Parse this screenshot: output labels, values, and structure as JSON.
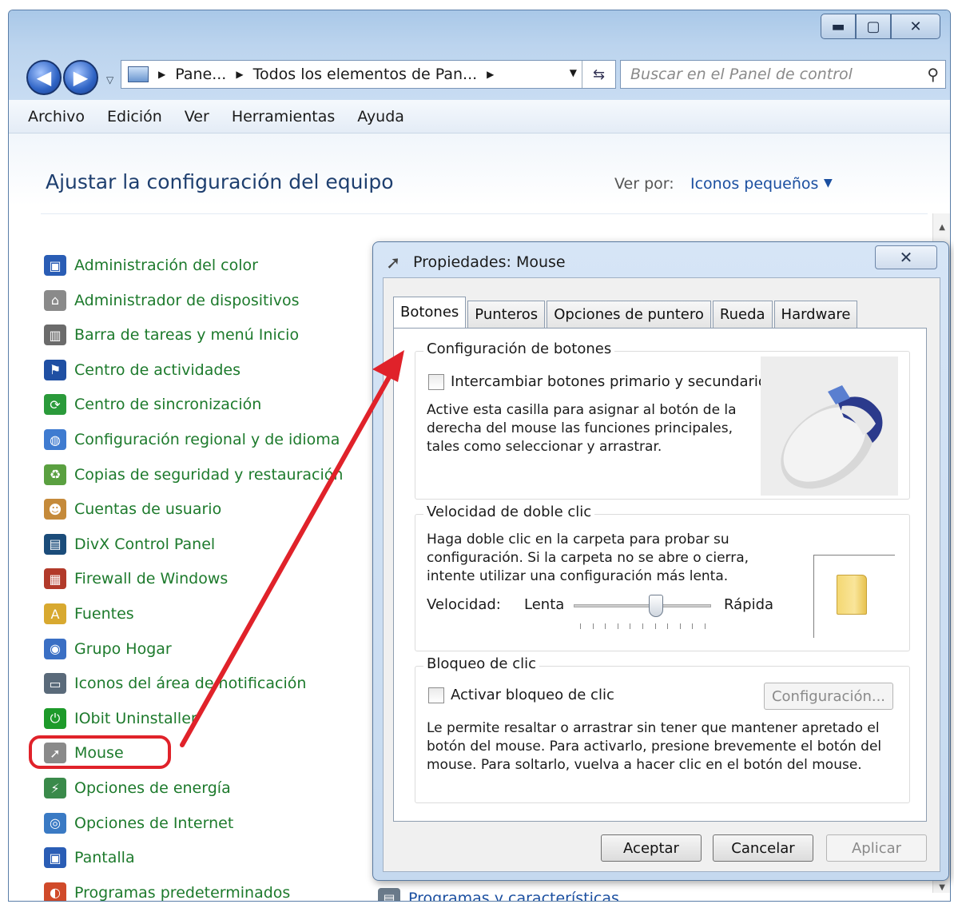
{
  "window": {
    "controls": {
      "minimize": "▬",
      "maximize": "▢",
      "close": "✕"
    }
  },
  "address": {
    "segments": [
      "Pane...",
      "Todos los elementos de Pan..."
    ],
    "search_placeholder": "Buscar en el Panel de control"
  },
  "menu": [
    "Archivo",
    "Edición",
    "Ver",
    "Herramientas",
    "Ayuda"
  ],
  "page": {
    "title": "Ajustar la configuración del equipo",
    "view_by_label": "Ver por:",
    "view_by_value": "Iconos pequeños"
  },
  "items": [
    {
      "label": "Administración del color",
      "icon": "monitor-color-icon",
      "color": "#2a5db5"
    },
    {
      "label": "Administrador de dispositivos",
      "icon": "device-manager-icon",
      "color": "#8a8a8a"
    },
    {
      "label": "Barra de tareas y menú Inicio",
      "icon": "taskbar-icon",
      "color": "#6b6b6b"
    },
    {
      "label": "Centro de actividades",
      "icon": "flag-icon",
      "color": "#1f4fa3"
    },
    {
      "label": "Centro de sincronización",
      "icon": "sync-icon",
      "color": "#2a9a3a"
    },
    {
      "label": "Configuración regional y de idioma",
      "icon": "globe-icon",
      "color": "#3f7bd0"
    },
    {
      "label": "Copias de seguridad y restauración",
      "icon": "backup-icon",
      "color": "#5aa040"
    },
    {
      "label": "Cuentas de usuario",
      "icon": "users-icon",
      "color": "#c58a3a"
    },
    {
      "label": "DivX Control Panel",
      "icon": "divx-icon",
      "color": "#1b4c7a"
    },
    {
      "label": "Firewall de Windows",
      "icon": "firewall-icon",
      "color": "#b23a2a"
    },
    {
      "label": "Fuentes",
      "icon": "fonts-icon",
      "color": "#d8a930"
    },
    {
      "label": "Grupo Hogar",
      "icon": "homegroup-icon",
      "color": "#3a6fc4"
    },
    {
      "label": "Iconos del área de notificación",
      "icon": "notification-icon",
      "color": "#5a6a7a"
    },
    {
      "label": "IObit Uninstaller",
      "icon": "iobit-icon",
      "color": "#1d9a2a"
    },
    {
      "label": "Mouse",
      "icon": "mouse-icon",
      "color": "#8a8a8a"
    },
    {
      "label": "Opciones de energía",
      "icon": "power-icon",
      "color": "#3a8a4a"
    },
    {
      "label": "Opciones de Internet",
      "icon": "internet-icon",
      "color": "#3a7ac4"
    },
    {
      "label": "Pantalla",
      "icon": "display-icon",
      "color": "#2a5db5"
    },
    {
      "label": "Programas predeterminados",
      "icon": "default-programs-icon",
      "color": "#d04a2a"
    }
  ],
  "partial_item": "Programas y características",
  "dialog": {
    "title": "Propiedades: Mouse",
    "close": "✕",
    "tabs": [
      "Botones",
      "Punteros",
      "Opciones de puntero",
      "Rueda",
      "Hardware"
    ],
    "buttons_group": {
      "title": "Configuración de botones",
      "checkbox_label": "Intercambiar botones primario y secundario",
      "description": "Active esta casilla para asignar al botón de la derecha del mouse las funciones principales, tales como seleccionar y arrastrar."
    },
    "double_click_group": {
      "title": "Velocidad de doble clic",
      "description": "Haga doble clic en la carpeta para probar su configuración. Si la carpeta no se abre o cierra, intente utilizar una configuración más lenta.",
      "speed_label": "Velocidad:",
      "slow_label": "Lenta",
      "fast_label": "Rápida",
      "slider_fraction": 0.6
    },
    "click_lock_group": {
      "title": "Bloqueo de clic",
      "checkbox_label": "Activar bloqueo de clic",
      "settings_button": "Configuración...",
      "description": "Le permite resaltar o arrastrar sin tener que mantener apretado el botón del mouse. Para activarlo, presione brevemente el botón del mouse. Para soltarlo, vuelva a hacer clic en el botón del mouse."
    },
    "footer": {
      "ok": "Aceptar",
      "cancel": "Cancelar",
      "apply": "Aplicar"
    }
  },
  "annotation": {
    "color": "#e0222a"
  }
}
